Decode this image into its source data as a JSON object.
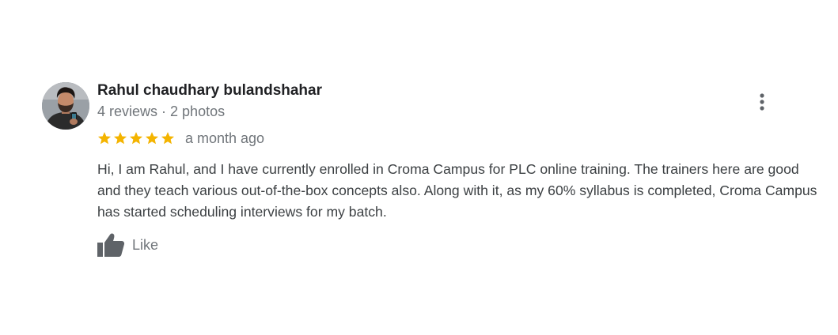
{
  "review": {
    "author": {
      "name": "Rahul chaudhary bulandshahar",
      "reviews": "4 reviews",
      "separator": "·",
      "photos": "2 photos",
      "avatar_icon": "user-photo-avatar"
    },
    "rating": {
      "stars": 5,
      "max": 5,
      "color": "#f4b400"
    },
    "date": "a month ago",
    "text": "Hi, I am Rahul, and I have currently enrolled in Croma Campus for PLC online training. The trainers here are good and they teach various out-of-the-box concepts also. Along with it, as my 60% syllabus is completed, Croma Campus has started scheduling interviews for my batch.",
    "actions": {
      "like_label": "Like",
      "like_icon": "thumbs-up-icon",
      "more_icon": "more-vert-icon"
    }
  },
  "colors": {
    "text_primary": "#202124",
    "text_secondary": "#70757a",
    "text_body": "#3c4043",
    "icon": "#5f6368",
    "star": "#f4b400"
  }
}
